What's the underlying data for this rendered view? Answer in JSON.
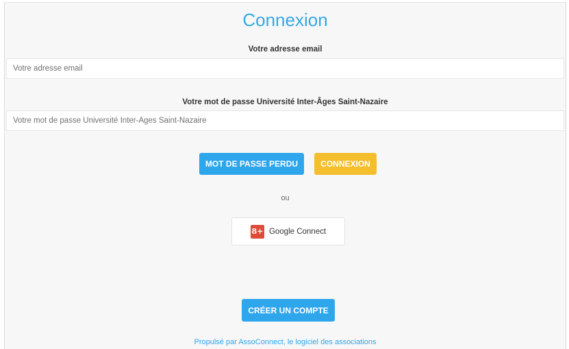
{
  "page": {
    "title": "Connexion"
  },
  "email": {
    "label": "Votre adresse email",
    "placeholder": "Votre adresse email",
    "value": ""
  },
  "password": {
    "label": "Votre mot de passe Université Inter-Âges Saint-Nazaire",
    "placeholder": "Votre mot de passe Université Inter-Âges Saint-Nazaire",
    "value": ""
  },
  "actions": {
    "lost_password_label": "MOT DE PASSE PERDU",
    "login_label": "CONNEXION",
    "or_text": "ou",
    "google_label": "Google Connect",
    "google_icon_glyph": "8+",
    "create_account_label": "CRÉER UN COMPTE"
  },
  "footer": {
    "link_text": "Propulsé par AssoConnect, le logiciel des associations"
  },
  "colors": {
    "accent_blue": "#2ea6ec",
    "title_blue": "#35a9e3",
    "login_yellow": "#f4be2c",
    "google_red": "#dd4b39",
    "background": "#f7f7f7"
  },
  "icons": {
    "google": "google-plus-icon"
  }
}
